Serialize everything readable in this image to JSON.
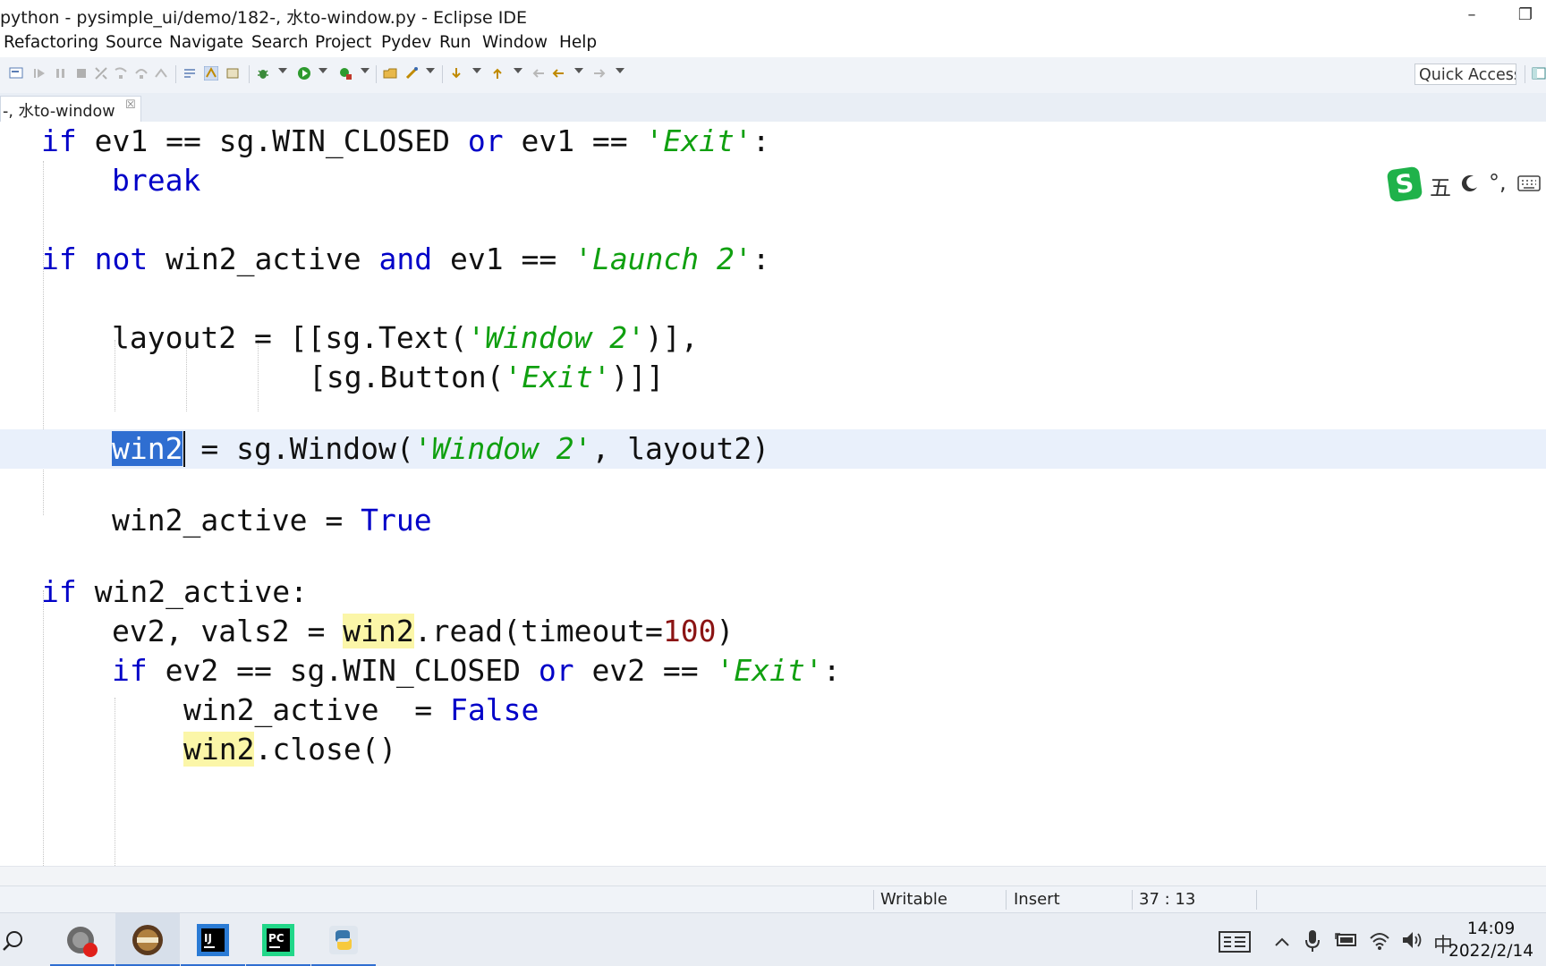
{
  "window": {
    "title": "python - pysimple_ui/demo/182-, 水to-window.py - Eclipse IDE",
    "minimize_glyph": "–",
    "restore_glyph": "❐"
  },
  "menu": [
    "Refactoring",
    "Source",
    "Navigate",
    "Search",
    "Project",
    "Pydev",
    "Run",
    "Window",
    "Help"
  ],
  "toolbar": {
    "quick_access": "Quick Access"
  },
  "tab": {
    "label": "-, 水to-window",
    "close_glyph": "☒"
  },
  "code": {
    "l1": {
      "if": "if",
      "a": " ev1 == sg.WIN_CLOSED ",
      "or": "or",
      "b": " ev1 == ",
      "s": "'Exit'",
      "c": ":"
    },
    "l2": {
      "kw": "break"
    },
    "l3": {
      "if": "if",
      "sp": " ",
      "not": "not",
      "a": " win2_active ",
      "and": "and",
      "b": " ev1 == ",
      "s": "'Launch 2'",
      "c": ":"
    },
    "l4": {
      "a": "layout2 = [[sg.Text(",
      "s": "'Window 2'",
      "b": ")],"
    },
    "l5": {
      "a": "[sg.Button(",
      "s": "'Exit'",
      "b": ")]]"
    },
    "l6": {
      "sel": "win2",
      "a": " = sg.Window(",
      "s": "'Window 2'",
      "b": ", layout2)"
    },
    "l7": {
      "a": "win2_active = ",
      "kw": "True"
    },
    "l8": {
      "if": "if",
      "a": " win2_active:"
    },
    "l9": {
      "a": "ev2, vals2 = ",
      "occ": "win2",
      "b": ".read(timeout=",
      "n": "100",
      "c": ")"
    },
    "l10": {
      "if": "if",
      "a": " ev2 == sg.WIN_CLOSED ",
      "or": "or",
      "b": " ev2 == ",
      "s": "'Exit'",
      "c": ":"
    },
    "l11": {
      "a": "win2_active  = ",
      "kw": "False"
    },
    "l12": {
      "occ": "win2",
      "a": ".close()"
    }
  },
  "ime": {
    "mode": "五",
    "punct": "°,"
  },
  "status": {
    "writable": "Writable",
    "insert_mode": "Insert",
    "position": "37 : 13"
  },
  "taskbar": {
    "time": "14:09",
    "date": "2022/2/14",
    "lang": "中"
  }
}
